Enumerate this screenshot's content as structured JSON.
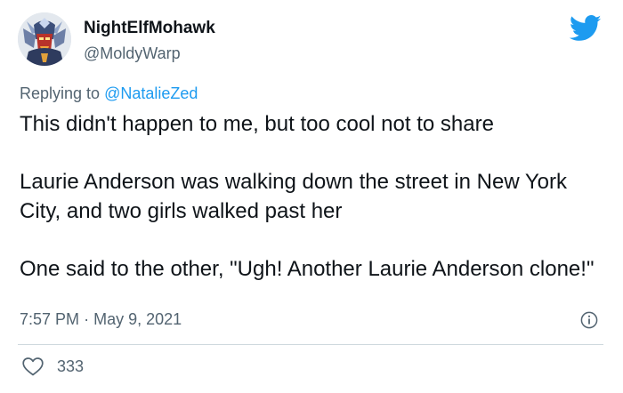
{
  "author": {
    "display_name": "NightElfMohawk",
    "handle": "@MoldyWarp"
  },
  "reply": {
    "prefix": "Replying to",
    "mention": "@NatalieZed"
  },
  "tweet": {
    "paragraphs": [
      "This didn't happen to me, but too cool not to share",
      "Laurie Anderson was walking down the street in New York City, and two girls walked past her",
      "One said to the other, \"Ugh! Another Laurie Anderson clone!\""
    ],
    "time": "7:57 PM",
    "separator": "·",
    "date": "May 9, 2021"
  },
  "engagement": {
    "likes": "333"
  },
  "icons": {
    "brand": "twitter-bird-icon",
    "info": "info-icon",
    "like": "heart-icon"
  },
  "colors": {
    "brand_blue": "#1d9bf0",
    "text": "#0f1419",
    "muted": "#536471",
    "divider": "#cfd9de"
  }
}
